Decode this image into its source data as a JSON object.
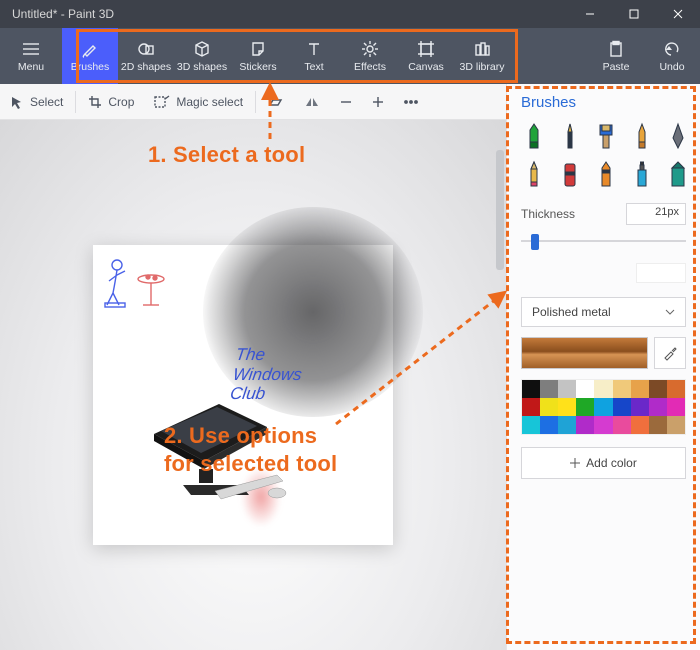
{
  "titlebar": {
    "title": "Untitled* - Paint 3D"
  },
  "mainbar": {
    "menu": "Menu",
    "items": [
      {
        "label": "Brushes",
        "active": true
      },
      {
        "label": "2D shapes"
      },
      {
        "label": "3D shapes"
      },
      {
        "label": "Stickers"
      },
      {
        "label": "Text"
      },
      {
        "label": "Effects"
      },
      {
        "label": "Canvas"
      },
      {
        "label": "3D library"
      }
    ],
    "paste": "Paste",
    "undo": "Undo"
  },
  "secondbar": {
    "select": "Select",
    "crop": "Crop",
    "magic": "Magic select"
  },
  "panel": {
    "title": "Brushes",
    "thickness_label": "Thickness",
    "thickness_value": "21px",
    "material": "Polished metal",
    "addcolor": "Add color"
  },
  "palette": [
    "#0f0f0f",
    "#7e7e7e",
    "#c3c3c3",
    "#ffffff",
    "#f7eec8",
    "#f0c97a",
    "#e7a24a",
    "#7c4a26",
    "#d86b2e",
    "#c11818",
    "#f0e11a",
    "#ffe11a",
    "#1fa826",
    "#0fa2e0",
    "#1646c9",
    "#6a28c9",
    "#b02bc9",
    "#e22bb5",
    "#17c5d8",
    "#1d6fe3",
    "#1fa3d6",
    "#b02bc9",
    "#d53bd0",
    "#e94b9d",
    "#f06f3d",
    "#9b6a3c",
    "#caa06a"
  ],
  "canvas_text": {
    "l1": "The",
    "l2": "Windows",
    "l3": "Club"
  },
  "annotations": {
    "step1": "1. Select a tool",
    "step2a": "2. Use options",
    "step2b": "for selected tool"
  }
}
